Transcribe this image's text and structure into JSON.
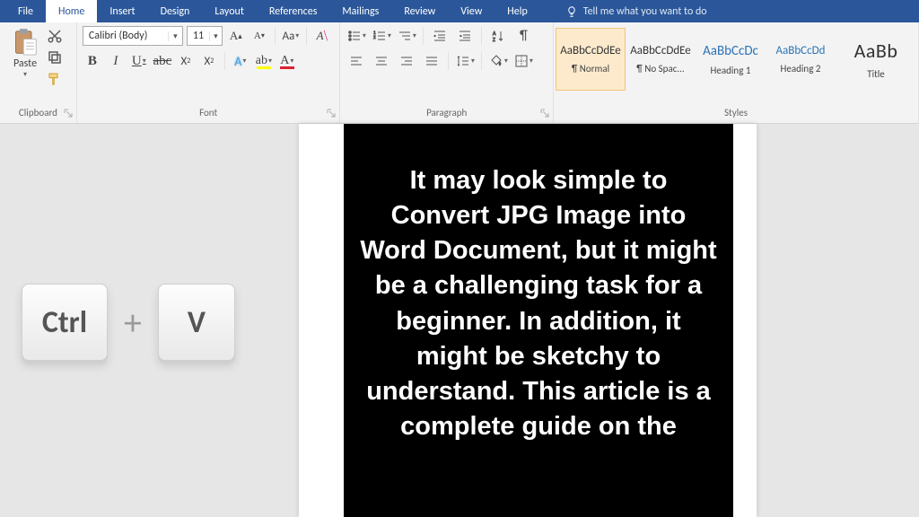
{
  "menu": {
    "tabs": [
      "File",
      "Home",
      "Insert",
      "Design",
      "Layout",
      "References",
      "Mailings",
      "Review",
      "View",
      "Help"
    ],
    "active": "Home",
    "tellme": "Tell me what you want to do"
  },
  "ribbon": {
    "clipboard": {
      "label": "Clipboard",
      "paste": "Paste"
    },
    "font": {
      "label": "Font",
      "name": "Calibri (Body)",
      "size": "11"
    },
    "paragraph": {
      "label": "Paragraph"
    },
    "styles": {
      "label": "Styles",
      "items": [
        {
          "preview": "AaBbCcDdEe",
          "name": "¶ Normal",
          "cls": "",
          "sel": true
        },
        {
          "preview": "AaBbCcDdEe",
          "name": "¶ No Spac...",
          "cls": "",
          "sel": false
        },
        {
          "preview": "AaBbCcDc",
          "name": "Heading 1",
          "cls": "h1",
          "sel": false
        },
        {
          "preview": "AaBbCcDd",
          "name": "Heading 2",
          "cls": "h2",
          "sel": false
        },
        {
          "preview": "AaBb",
          "name": "Title",
          "cls": "title",
          "sel": false
        }
      ]
    }
  },
  "document": {
    "text": "It may look simple to Convert JPG Image into Word Document, but it might be a challenging task for a beginner. In addition, it might be sketchy to understand. This article is a complete guide on the"
  },
  "shortcut": {
    "key1": "Ctrl",
    "sep": "+",
    "key2": "V"
  }
}
